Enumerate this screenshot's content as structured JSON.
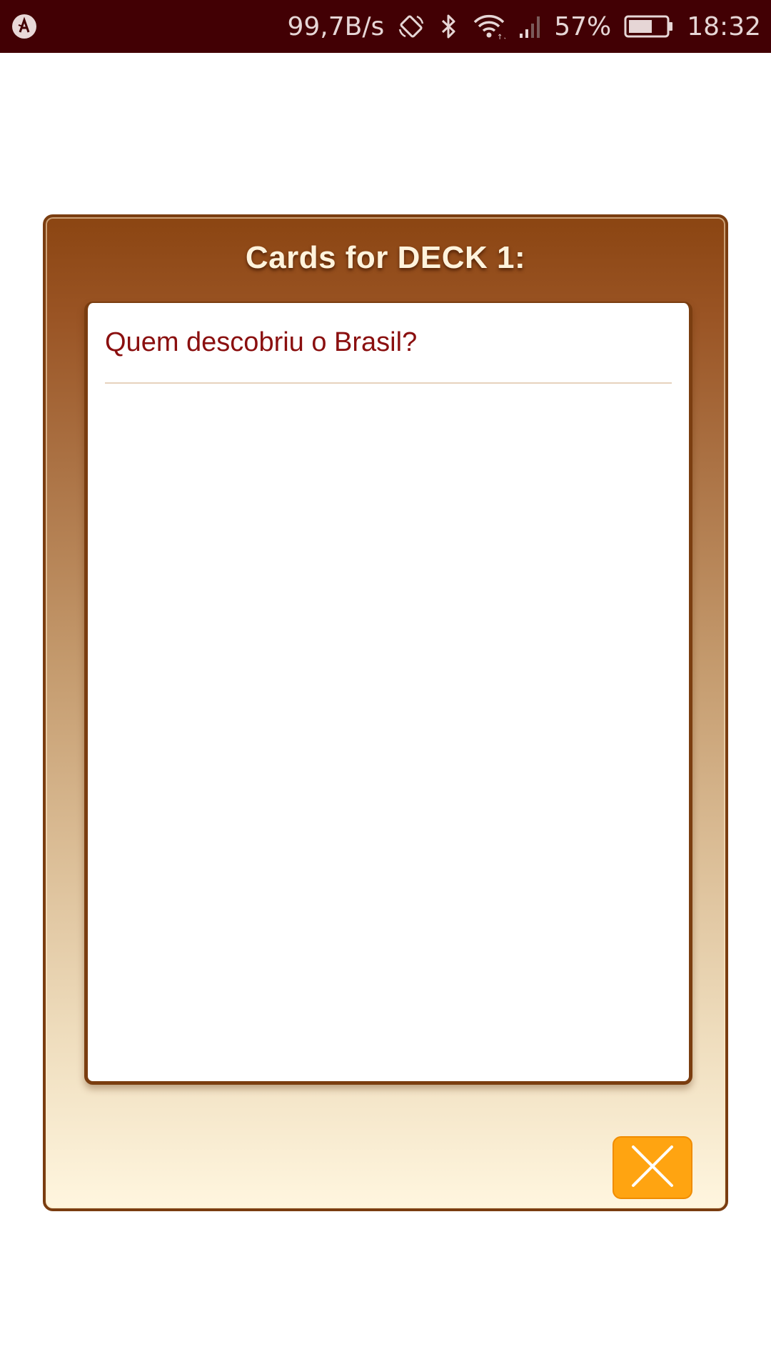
{
  "status_bar": {
    "app_icon": "android-debug-icon",
    "network_speed": "99,7B/s",
    "rotation_icon": "auto-rotate-icon",
    "bluetooth_icon": "bluetooth-icon",
    "wifi_icon": "wifi-icon",
    "signal_icon": "cell-signal-icon",
    "battery_percent": "57%",
    "battery_icon": "battery-icon",
    "time": "18:32",
    "background_color": "#420004"
  },
  "dialog": {
    "title": "Cards for DECK 1:",
    "card": {
      "question": "Quem descobriu o Brasil?"
    },
    "close_button": {
      "icon": "close-icon",
      "color": "#ffa411"
    }
  },
  "colors": {
    "frame_border": "#7a3d10",
    "title_text": "#fff3dc",
    "question_text": "#8a0f0f"
  }
}
